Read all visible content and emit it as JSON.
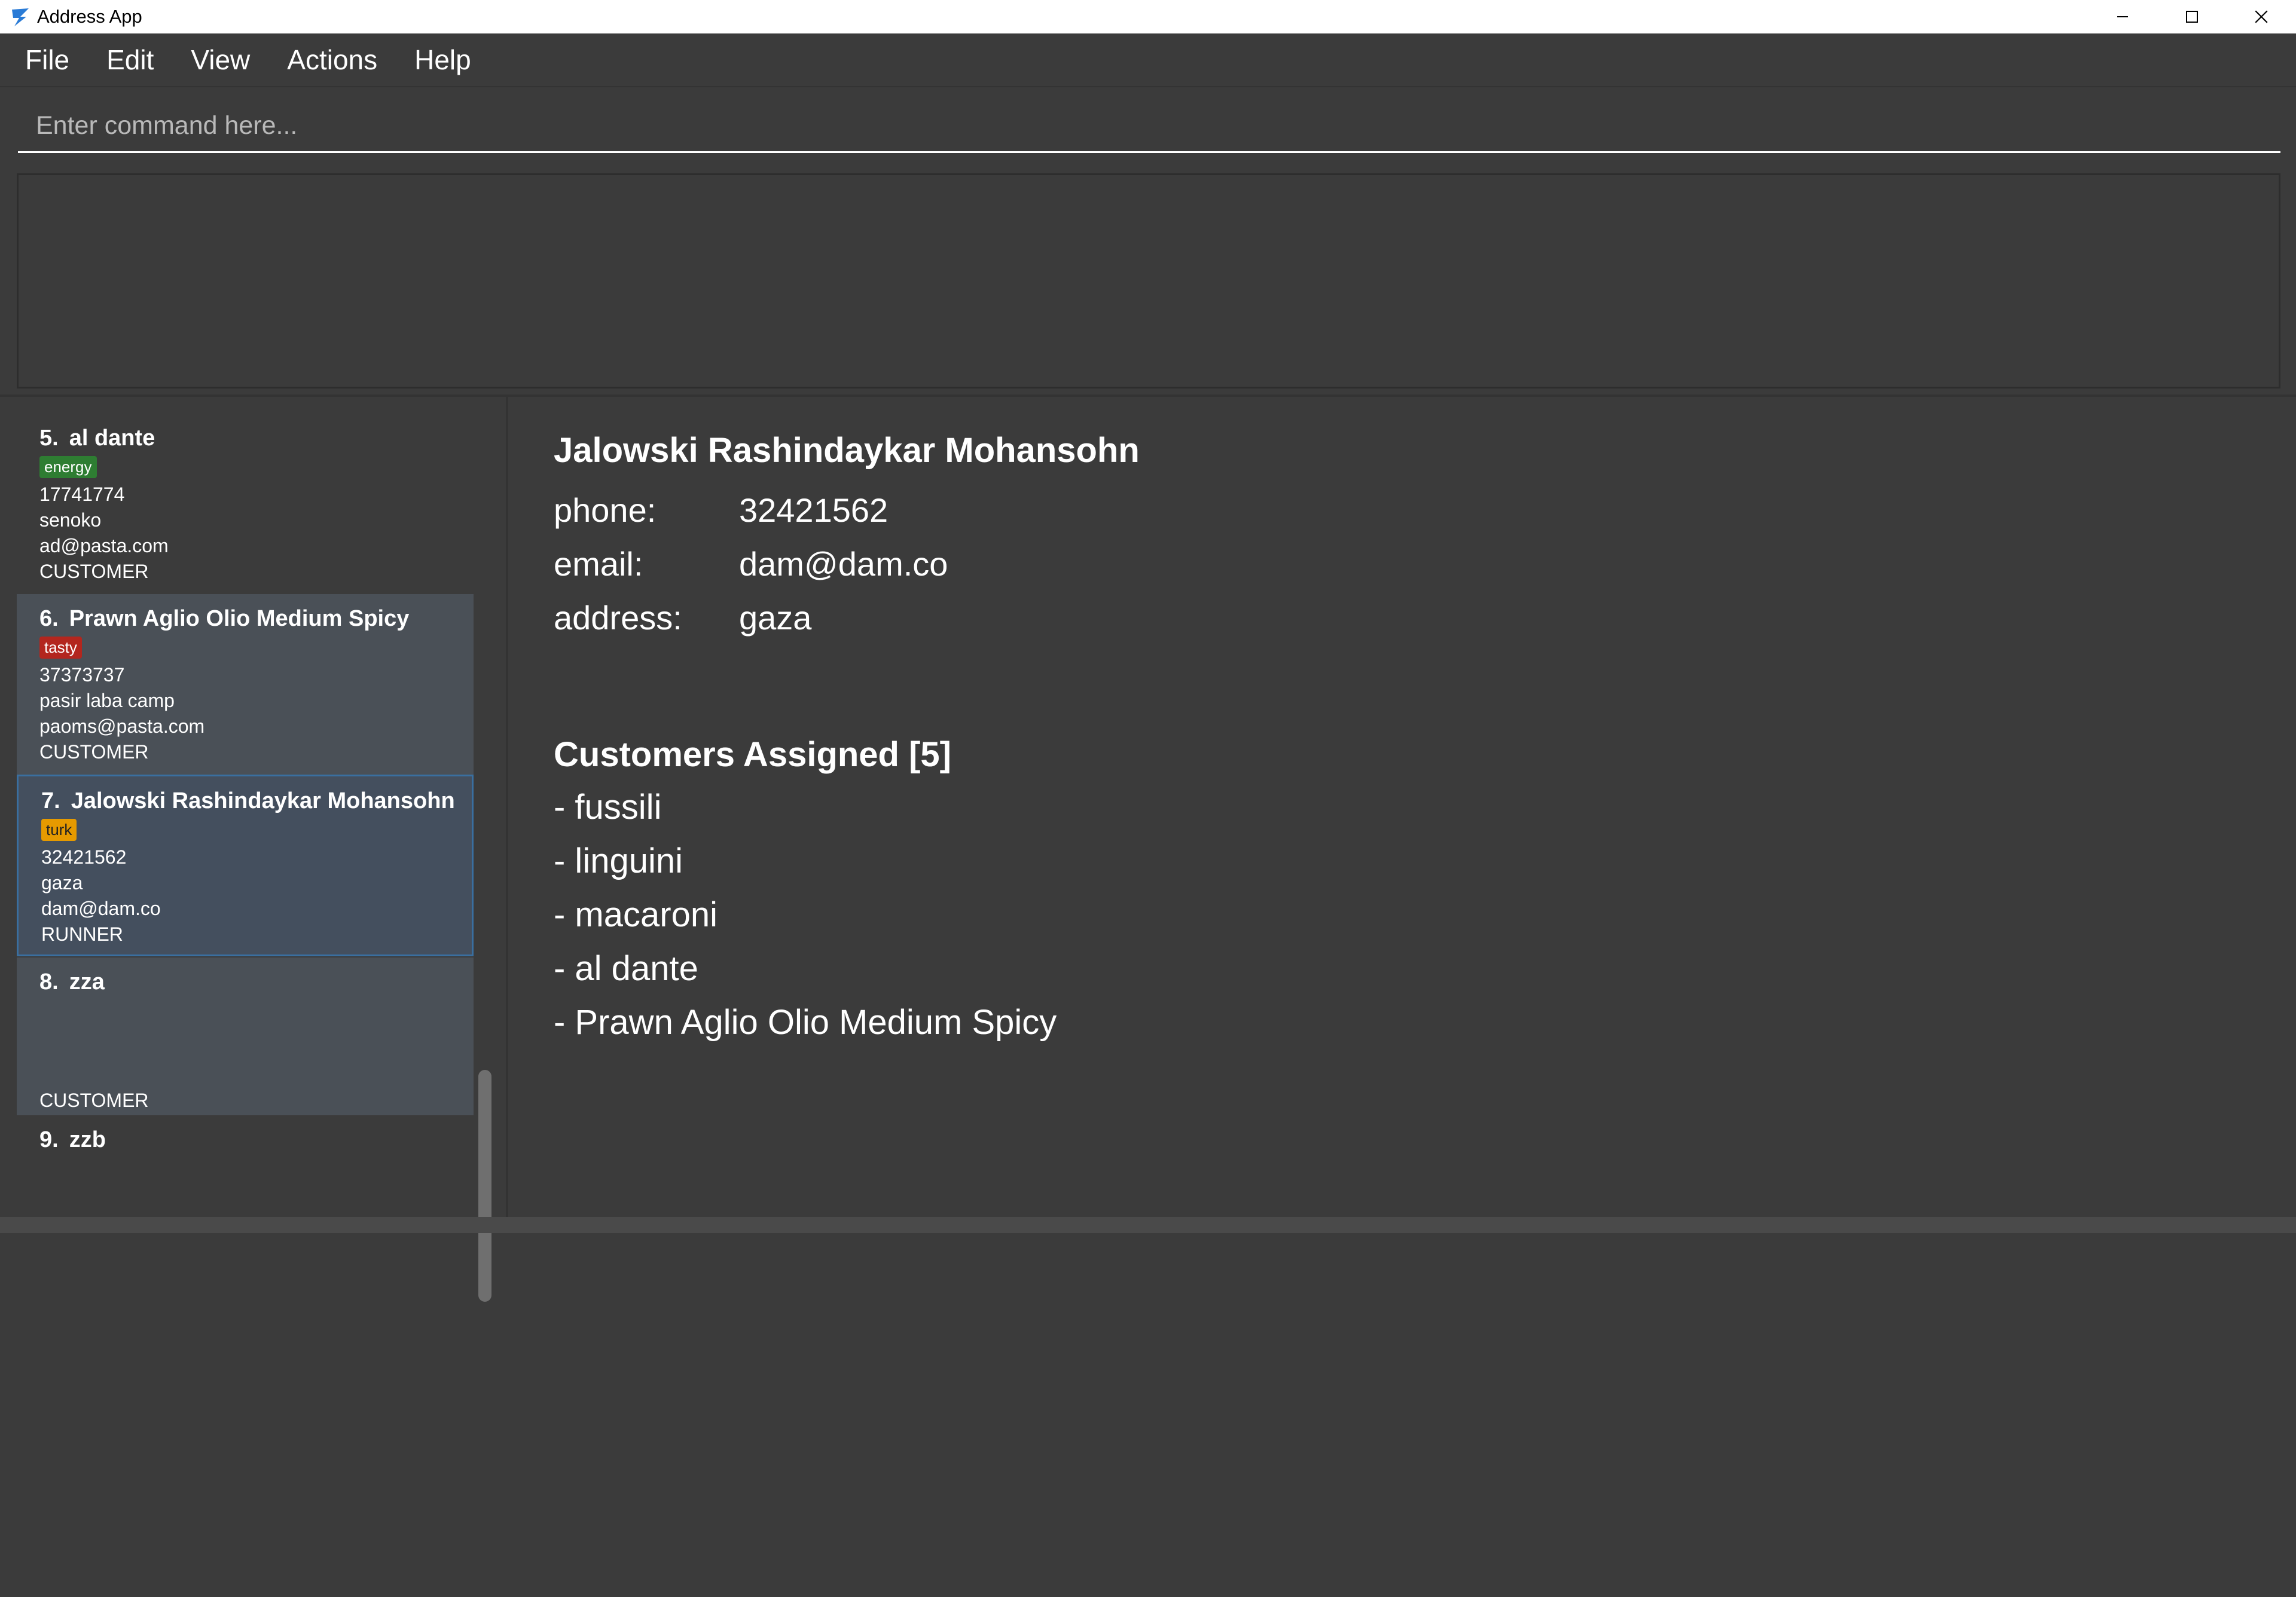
{
  "window": {
    "title": "Address App"
  },
  "menu": [
    "File",
    "Edit",
    "View",
    "Actions",
    "Help"
  ],
  "command": {
    "placeholder": "Enter command here..."
  },
  "list": {
    "items": [
      {
        "index": "5.",
        "name": "al dante",
        "tag": "energy",
        "tag_color": "#2e7d32",
        "phone": "17741774",
        "address": "senoko",
        "email": "ad@pasta.com",
        "role": "CUSTOMER"
      },
      {
        "index": "6.",
        "name": "Prawn Aglio Olio Medium Spicy",
        "tag": "tasty",
        "tag_color": "#b3261e",
        "phone": "37373737",
        "address": "pasir laba camp",
        "email": "paoms@pasta.com",
        "role": "CUSTOMER"
      },
      {
        "index": "7.",
        "name": "Jalowski Rashindaykar Mohansohn",
        "tag": "turk",
        "tag_color": "#e69a00",
        "phone": "32421562",
        "address": "gaza",
        "email": "dam@dam.co",
        "role": "RUNNER"
      },
      {
        "index": "8.",
        "name": "zza",
        "role": "CUSTOMER"
      },
      {
        "index": "9.",
        "name": "zzb"
      }
    ]
  },
  "detail": {
    "name": "Jalowski Rashindaykar Mohansohn",
    "phone_label": "phone:",
    "phone": "32421562",
    "email_label": "email:",
    "email": "dam@dam.co",
    "address_label": "address:",
    "address": "gaza",
    "customers_title": "Customers Assigned [5]",
    "customers": [
      "- fussili",
      "- linguini",
      "- macaroni",
      "- al dante",
      "- Prawn Aglio Olio Medium Spicy"
    ]
  }
}
